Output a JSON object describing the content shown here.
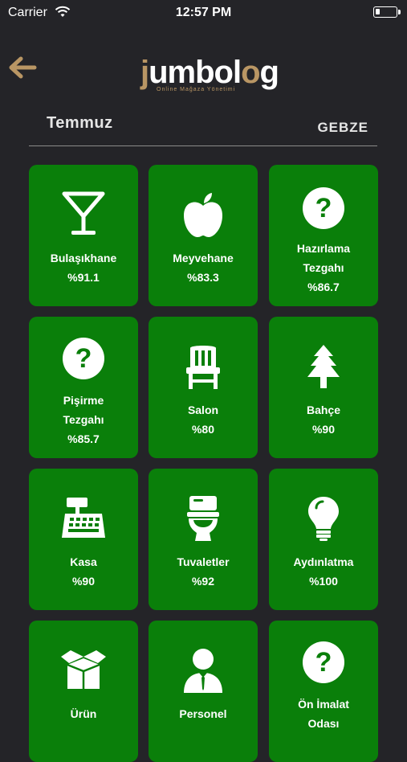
{
  "status_bar": {
    "carrier": "Carrier",
    "time": "12:57 PM"
  },
  "header": {
    "logo_main": "jumbolog",
    "logo_j": "j",
    "logo_mid": "umbol",
    "logo_o": "o",
    "logo_end": "g",
    "logo_tagline": "Online Mağaza Yönetimi"
  },
  "filters": {
    "month": "Temmuz",
    "location": "GEBZE"
  },
  "colors": {
    "tile_green": "#0a7f0a",
    "background": "#242428",
    "brand_gold": "#b99664"
  },
  "tiles": [
    {
      "icon": "cocktail-glass-icon",
      "lines": [
        "Bulaşıkhane",
        "%91.1"
      ]
    },
    {
      "icon": "apple-icon",
      "lines": [
        "Meyvehane",
        "%83.3"
      ]
    },
    {
      "icon": "question-circle-icon",
      "lines": [
        "Hazırlama",
        "Tezgahı",
        "%86.7"
      ]
    },
    {
      "icon": "question-circle-icon",
      "lines": [
        "Pişirme",
        "Tezgahı",
        "%85.7"
      ]
    },
    {
      "icon": "chair-icon",
      "lines": [
        "Salon",
        "%80"
      ]
    },
    {
      "icon": "tree-icon",
      "lines": [
        "Bahçe",
        "%90"
      ]
    },
    {
      "icon": "cash-register-icon",
      "lines": [
        "Kasa",
        "%90"
      ]
    },
    {
      "icon": "toilet-icon",
      "lines": [
        "Tuvaletler",
        "%92"
      ]
    },
    {
      "icon": "lightbulb-icon",
      "lines": [
        "Aydınlatma",
        "%100"
      ]
    },
    {
      "icon": "box-icon",
      "lines": [
        "Ürün"
      ]
    },
    {
      "icon": "person-icon",
      "lines": [
        "Personel"
      ]
    },
    {
      "icon": "question-circle-icon",
      "lines": [
        "Ön İmalat",
        "Odası"
      ]
    }
  ]
}
